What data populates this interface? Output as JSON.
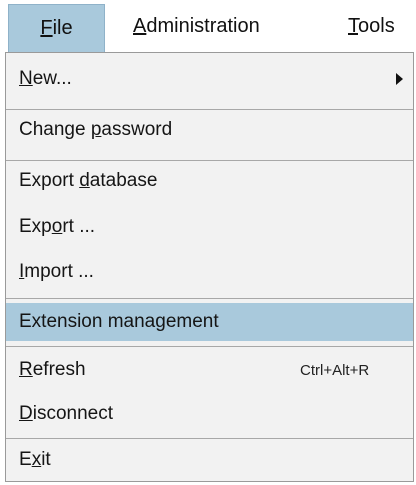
{
  "menubar": {
    "file_pre": "",
    "file_u": "F",
    "file_post": "ile",
    "admin_pre": "",
    "admin_u": "A",
    "admin_post": "dministration",
    "tools_pre": "",
    "tools_u": "T",
    "tools_post": "ools"
  },
  "menu": {
    "new": {
      "pre": "",
      "u": "N",
      "post": "ew..."
    },
    "change_password": {
      "pre": "Change ",
      "u": "p",
      "post": "assword"
    },
    "export_database": {
      "pre": "Export ",
      "u": "d",
      "post": "atabase"
    },
    "export": {
      "pre": "Exp",
      "u": "o",
      "post": "rt ..."
    },
    "import": {
      "pre": "",
      "u": "I",
      "post": "mport ..."
    },
    "extension_management": {
      "label": "Extension management"
    },
    "refresh": {
      "pre": "",
      "u": "R",
      "post": "efresh",
      "shortcut": "Ctrl+Alt+R"
    },
    "disconnect": {
      "pre": "",
      "u": "D",
      "post": "isconnect"
    },
    "exit": {
      "pre": "E",
      "u": "x",
      "post": "it"
    }
  },
  "colors": {
    "highlight": "#a9c9dc",
    "menu_background": "#f2f2f2",
    "separator": "#a8a8a8"
  }
}
